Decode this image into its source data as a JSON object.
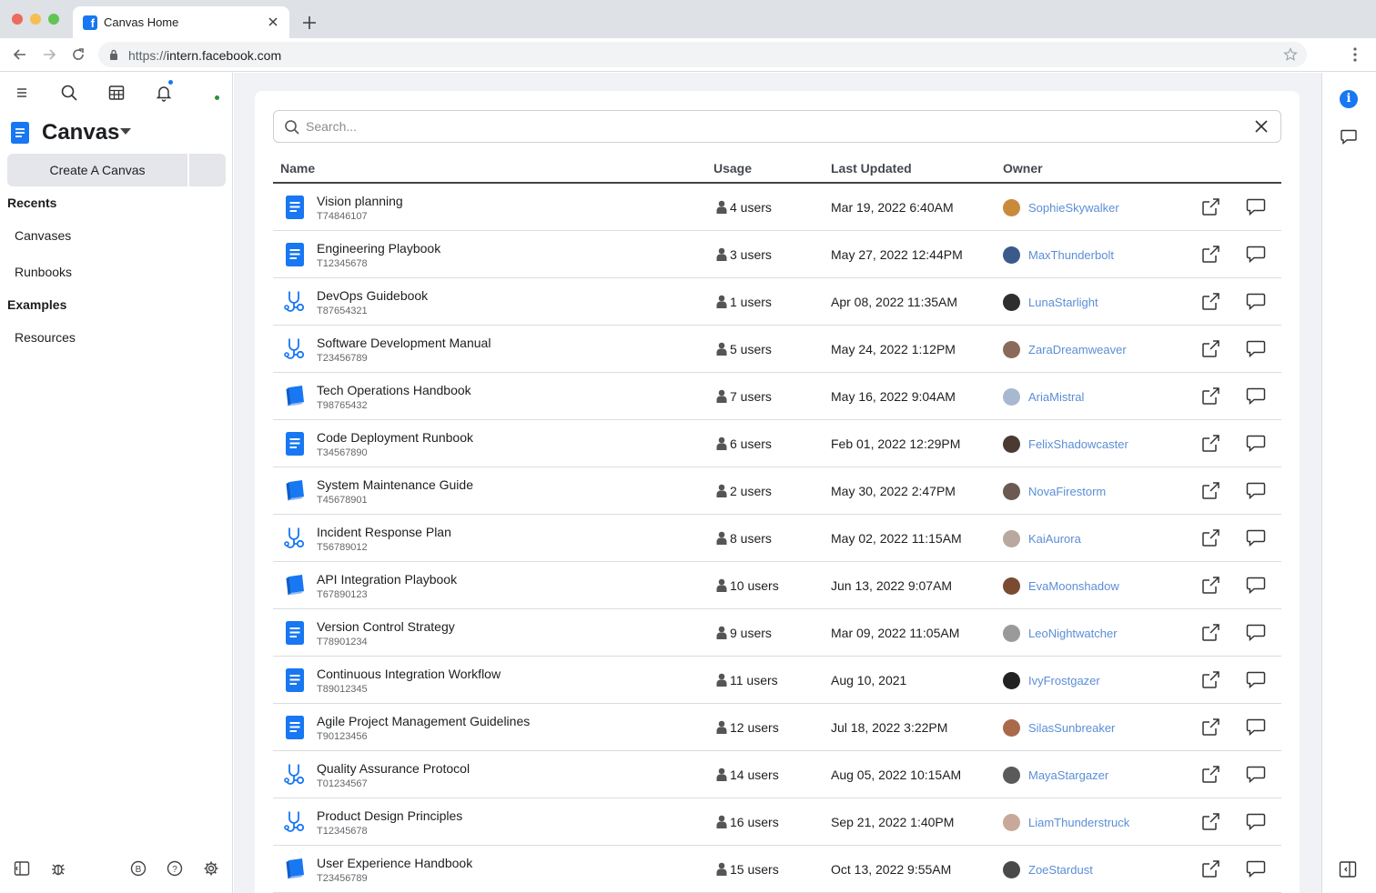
{
  "browser": {
    "tab_title": "Canvas Home",
    "url_scheme": "https://",
    "url_host": "intern.facebook.com"
  },
  "sidebar": {
    "app_title": "Canvas",
    "create_button": "Create A Canvas",
    "sections": [
      {
        "label": "Recents",
        "items": [
          "Canvases",
          "Runbooks"
        ]
      },
      {
        "label": "Examples",
        "items": [
          "Resources"
        ]
      }
    ]
  },
  "search": {
    "placeholder": "Search...",
    "value": ""
  },
  "table": {
    "columns": [
      "Name",
      "Usage",
      "Last Updated",
      "Owner"
    ],
    "rows": [
      {
        "name": "Vision planning",
        "id": "T74846107",
        "icon": "doc-icon",
        "usage": "4 users",
        "updated": "Mar 19, 2022 6:40AM",
        "owner": "SophieSkywalker",
        "avatar_color": "#c98a3b"
      },
      {
        "name": "Engineering Playbook",
        "id": "T12345678",
        "icon": "doc-icon",
        "usage": "3 users",
        "updated": "May 27, 2022 12:44PM",
        "owner": "MaxThunderbolt",
        "avatar_color": "#3a5a8c"
      },
      {
        "name": "DevOps Guidebook",
        "id": "T87654321",
        "icon": "stethoscope-icon",
        "usage": "1 users",
        "updated": "Apr 08, 2022 11:35AM",
        "owner": "LunaStarlight",
        "avatar_color": "#2e2e2e"
      },
      {
        "name": "Software Development Manual",
        "id": "T23456789",
        "icon": "stethoscope-icon",
        "usage": "5 users",
        "updated": "May 24, 2022 1:12PM",
        "owner": "ZaraDreamweaver",
        "avatar_color": "#8a6a5a"
      },
      {
        "name": "Tech Operations Handbook",
        "id": "T98765432",
        "icon": "book-icon",
        "usage": "7 users",
        "updated": "May 16, 2022 9:04AM",
        "owner": "AriaMistral",
        "avatar_color": "#a8b8d0"
      },
      {
        "name": "Code Deployment Runbook",
        "id": "T34567890",
        "icon": "doc-icon",
        "usage": "6 users",
        "updated": "Feb 01, 2022 12:29PM",
        "owner": "FelixShadowcaster",
        "avatar_color": "#4a3a32"
      },
      {
        "name": "System Maintenance Guide",
        "id": "T45678901",
        "icon": "book-icon",
        "usage": "2 users",
        "updated": "May 30, 2022 2:47PM",
        "owner": "NovaFirestorm",
        "avatar_color": "#6a5a52"
      },
      {
        "name": "Incident Response Plan",
        "id": "T56789012",
        "icon": "stethoscope-icon",
        "usage": "8 users",
        "updated": "May 02, 2022 11:15AM",
        "owner": "KaiAurora",
        "avatar_color": "#b8a8a0"
      },
      {
        "name": "API Integration Playbook",
        "id": "T67890123",
        "icon": "book-icon",
        "usage": "10 users",
        "updated": "Jun 13, 2022 9:07AM",
        "owner": "EvaMoonshadow",
        "avatar_color": "#7a4a32"
      },
      {
        "name": "Version Control Strategy",
        "id": "T78901234",
        "icon": "doc-icon",
        "usage": "9 users",
        "updated": "Mar 09, 2022 11:05AM",
        "owner": "LeoNightwatcher",
        "avatar_color": "#9a9a9a"
      },
      {
        "name": "Continuous Integration Workflow",
        "id": "T89012345",
        "icon": "doc-icon",
        "usage": "11 users",
        "updated": "Aug 10, 2021",
        "owner": "IvyFrostgazer",
        "avatar_color": "#222222"
      },
      {
        "name": "Agile Project Management Guidelines",
        "id": "T90123456",
        "icon": "doc-icon",
        "usage": "12 users",
        "updated": "Jul 18, 2022 3:22PM",
        "owner": "SilasSunbreaker",
        "avatar_color": "#a86a4a"
      },
      {
        "name": "Quality Assurance Protocol",
        "id": "T01234567",
        "icon": "stethoscope-icon",
        "usage": "14 users",
        "updated": "Aug 05, 2022 10:15AM",
        "owner": "MayaStargazer",
        "avatar_color": "#5a5a5a"
      },
      {
        "name": "Product Design Principles",
        "id": "T12345678",
        "icon": "stethoscope-icon",
        "usage": "16 users",
        "updated": "Sep 21, 2022 1:40PM",
        "owner": "LiamThunderstruck",
        "avatar_color": "#c8a898"
      },
      {
        "name": "User Experience Handbook",
        "id": "T23456789",
        "icon": "book-icon",
        "usage": "15 users",
        "updated": "Oct 13, 2022 9:55AM",
        "owner": "ZoeStardust",
        "avatar_color": "#4a4a4a"
      }
    ]
  },
  "colors": {
    "accent": "#1877f2",
    "owner_link": "#5b8ed6",
    "main_background": "#f0f2f5"
  }
}
